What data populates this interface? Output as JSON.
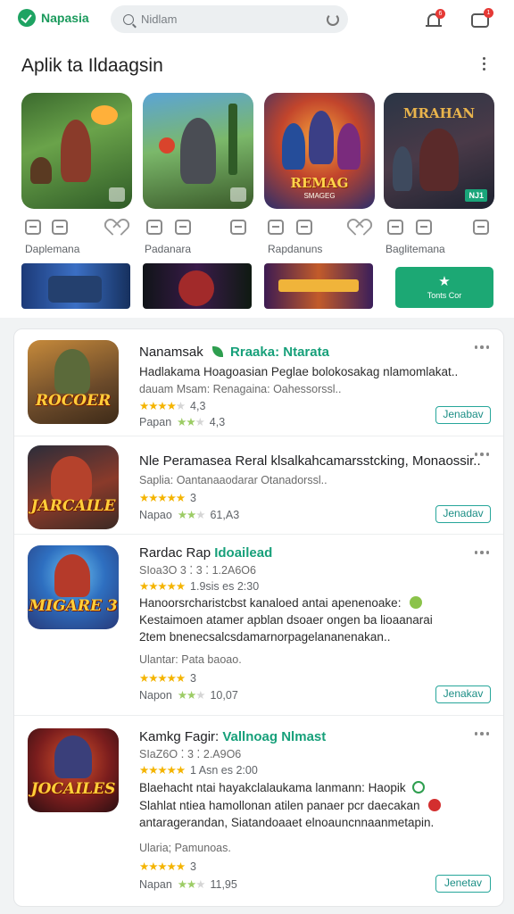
{
  "topbar": {
    "app_name": "Napasia",
    "search_placeholder": "Nidlam",
    "bell_badge": "6",
    "chat_badge": "1",
    "colors": {
      "brand": "#1ea362",
      "badge": "#e53935"
    }
  },
  "featured": {
    "title": "Aplik ta Ildaagsin",
    "tiles": [
      {
        "top_text": "",
        "bottom_text": "",
        "sub_text": "",
        "corner": "check"
      },
      {
        "top_text": "",
        "bottom_text": "",
        "sub_text": "",
        "corner": "check"
      },
      {
        "top_text": "",
        "bottom_text": "REMAG",
        "sub_text": "SMAGEG",
        "corner": ""
      },
      {
        "top_text": "MRAHAN",
        "bottom_text": "",
        "sub_text": "",
        "corner": "NJ1"
      }
    ],
    "captions": [
      "Daplemana",
      "Padanara",
      "Rapdanuns",
      "Baglitemana"
    ],
    "banner_cta_label": "Tonts Cor",
    "banner_cta_icon": "star-icon",
    "accent_color": "#1ca874"
  },
  "apps": [
    {
      "title": "Nanamsak",
      "title_accent": "Rraaka: Ntarata",
      "description": "Hadlakama Hoagoasian Peglae bolokosakag nlamomlakat..",
      "subtitle": "dauam Msam: Renagaina: Oahessorssl..",
      "rating_text": "4,3",
      "footer_label": "Papan",
      "footer_value": "4,3",
      "icon_label": "ROCOER",
      "install_label": "Jenabav"
    },
    {
      "title": "Nle Peramasea Reral klsalkahcamarsstcking, Monaossir..",
      "title_accent": "",
      "description": "Saplia: Oantanaaodarar Otanadorssl..",
      "subtitle": "",
      "rating_text": "3",
      "footer_label": "Napao",
      "footer_value": "61,A3",
      "icon_label": "JARCAILE",
      "install_label": "Jenadav"
    },
    {
      "title": "Rardac Rap",
      "title_accent": "Idoailead",
      "meta": "SIoa3O 3 ⁚ 3 ⁚ 1.2A6O6",
      "rating_line": "1.9sis es 2:30",
      "description": "Hanoorsrcharistcbst kanaloed antai apenenoake:",
      "description2": "Kestaimoen atamer apblan dsoaer ongen ba lioaanarai",
      "description3": "2tem bnenecsalcsdamarnorpagelananenakan..",
      "subtitle": "Ulantar: Pata baoao.",
      "rating_text": "3",
      "footer_label": "Napon",
      "footer_value": "10,07",
      "icon_label": "MIGARE 3",
      "install_label": "Jenakav"
    },
    {
      "title": "Kamkg Fagir:",
      "title_accent": "Vallnoag Nlmast",
      "meta": "SIaZ6O ⁚ 3 ⁚ 2.A9O6",
      "rating_line": "1 Asn es 2:00",
      "description": "Blaehacht ntai hayakclalaukama lanmann: Haopik",
      "description2": "Slahlat ntiea hamollonan atilen panaer pcr daecakan",
      "description3": "antaragerandan, Siatandoaaet elnoauncnnaanmetapin.",
      "subtitle": "Ularia; Pamunoas.",
      "rating_text": "3",
      "footer_label": "Napan",
      "footer_value": "11,95",
      "icon_label": "JOCAILES",
      "install_label": "Jenetav"
    }
  ]
}
